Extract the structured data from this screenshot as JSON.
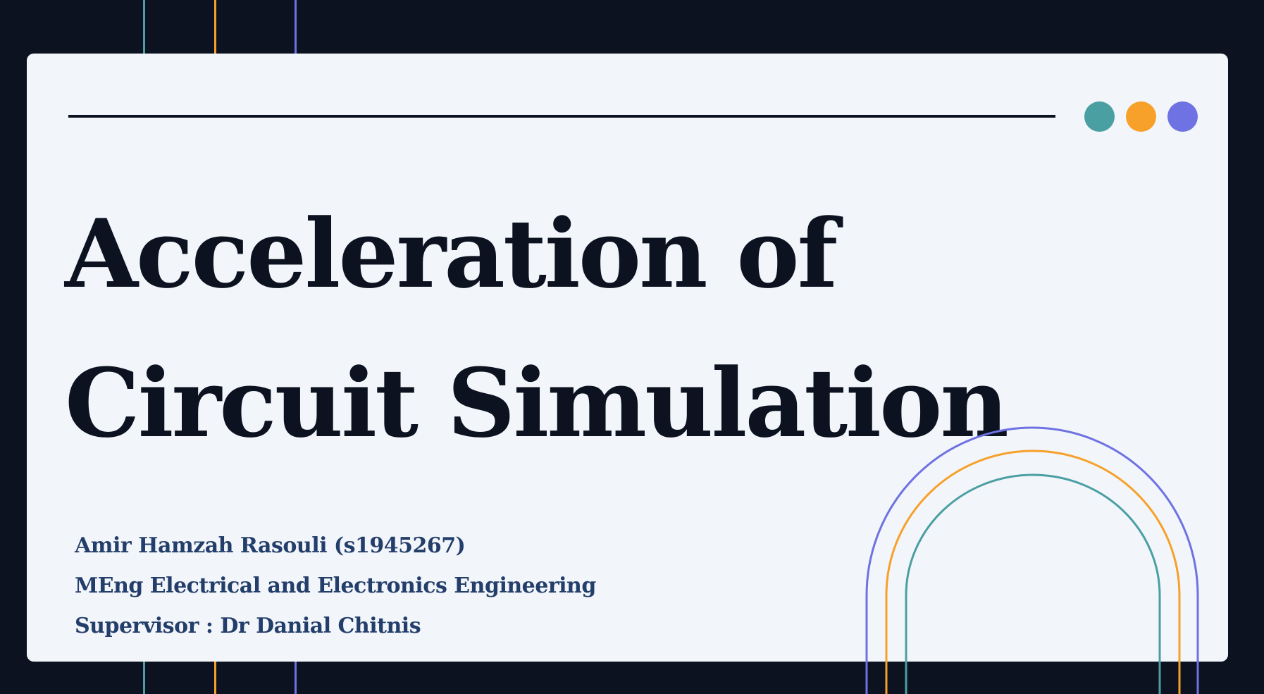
{
  "slide": {
    "title_line_1": "Acceleration of",
    "title_line_2": "Circuit Simulation",
    "author": "Amir Hamzah Rasouli (s1945267)",
    "programme": "MEng Electrical and Electronics Engineering",
    "supervisor": "Supervisor : Dr Danial Chitnis"
  },
  "colors": {
    "background": "#0c1220",
    "card": "#f2f6fa",
    "text_dark": "#0c1220",
    "text_blue": "#243e6b",
    "teal": "#4a9fa2",
    "orange": "#f7a02a",
    "purple": "#6e72e3"
  }
}
